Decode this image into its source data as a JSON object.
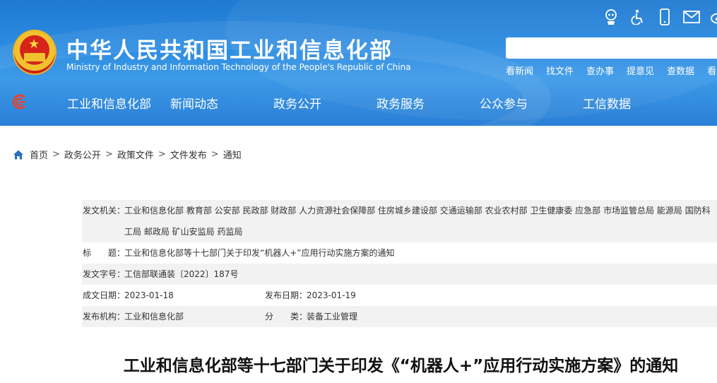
{
  "header": {
    "site_title": "中华人民共和国工业和信息化部",
    "site_subtitle": "Ministry of Industry and Information Technology of the People's Republic of China",
    "utility_icons": [
      "robot-icon",
      "accessibility-icon",
      "mobile-icon",
      "mail-icon",
      "weibo-icon"
    ],
    "search_value": "",
    "quick_links": [
      "看新闻",
      "找文件",
      "查办事",
      "提意见",
      "查数据",
      "看"
    ]
  },
  "nav": {
    "items": [
      "工业和信息化部",
      "新闻动态",
      "政务公开",
      "政务服务",
      "公众参与",
      "工信数据"
    ]
  },
  "breadcrumb": {
    "items": [
      "首页",
      "政务公开",
      "政策文件",
      "文件发布",
      "通知"
    ],
    "separator": ">"
  },
  "info": {
    "issuer_label": "发文机关：",
    "issuer_value": "工业和信息化部 教育部 公安部 民政部 财政部 人力资源社会保障部 住房城乡建设部 交通运输部 农业农村部 卫生健康委 应急部 市场监管总局 能源局 国防科工局 邮政局 矿山安监局 药监局",
    "title_label": "标　　题：",
    "title_value": "工业和信息化部等十七部门关于印发“机器人+”应用行动实施方案的通知",
    "doc_no_label": "发文字号：",
    "doc_no_value": "工信部联通装〔2022〕187号",
    "created_label": "成文日期：",
    "created_value": "2023-01-18",
    "published_label": "发布日期：",
    "published_value": "2023-01-19",
    "org_label": "发布机构：",
    "org_value": "工业和信息化部",
    "category_label": "分　　类：",
    "category_value": "装备工业管理"
  },
  "article": {
    "title": "工业和信息化部等十七部门关于印发《“机器人+”应用行动实施方案》的通知"
  },
  "colors": {
    "header_blue": "#2b8ae0",
    "row_shade": "#f2f2f2",
    "breadcrumb_home": "#2a6fc0"
  }
}
